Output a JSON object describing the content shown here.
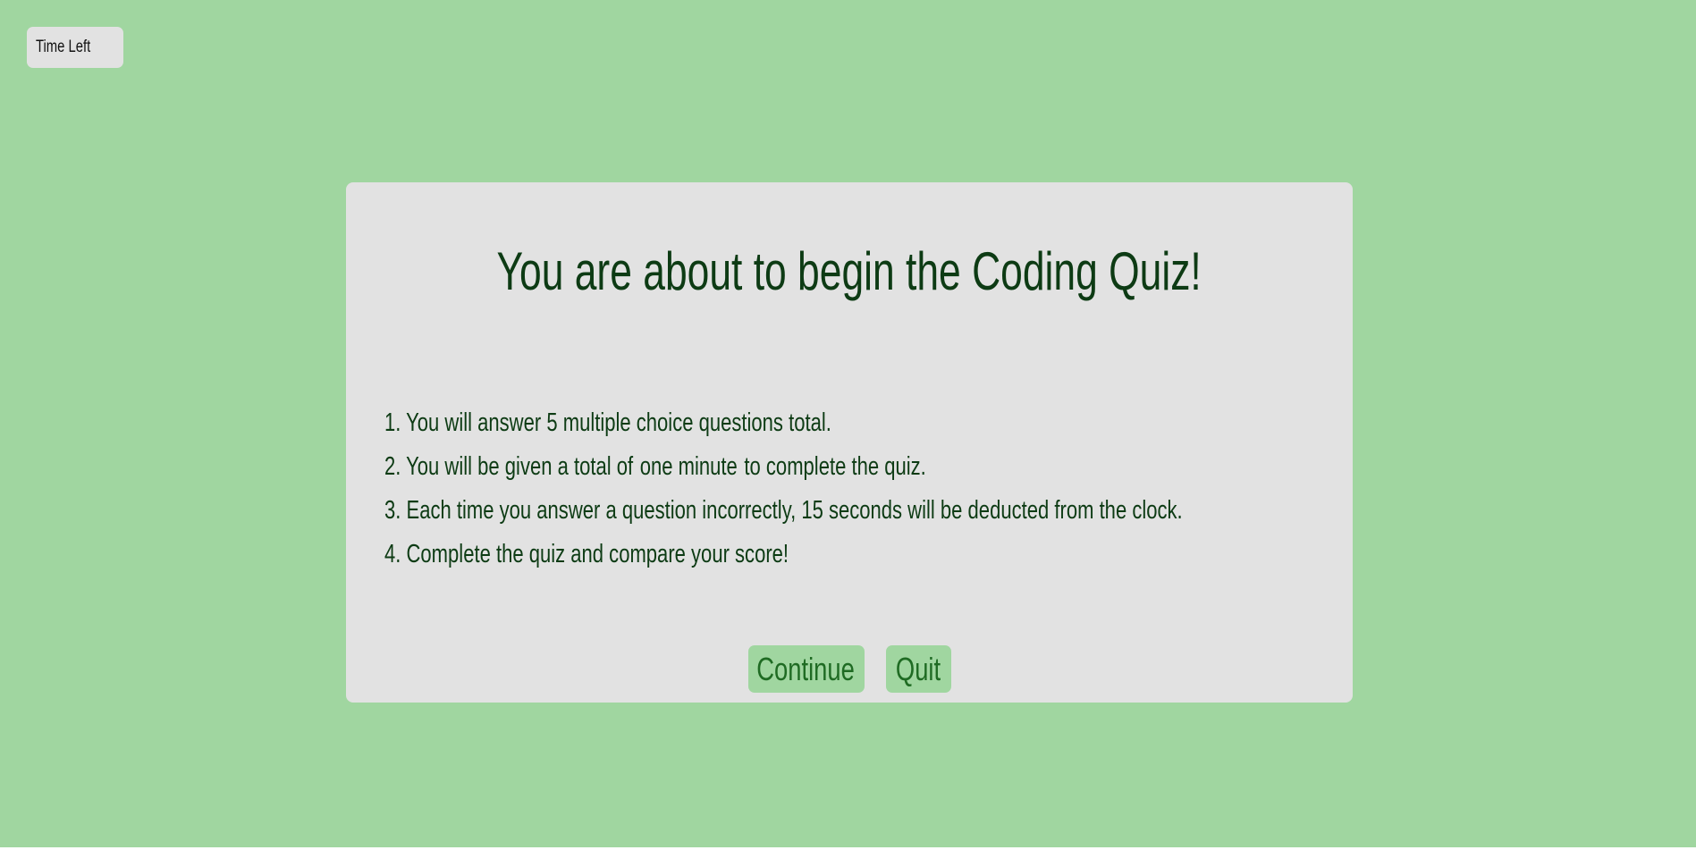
{
  "timer": {
    "label": "Time Left"
  },
  "intro": {
    "title": "You are about to begin the Coding Quiz!",
    "rules": [
      {
        "prefix": "1. You will answer 5 multiple choice questions total."
      },
      {
        "prefix": "2. You will be given a total of",
        "highlight": "one minute",
        "suffix": "to complete the quiz."
      },
      {
        "prefix": "3. Each time you answer a question incorrectly, 15 seconds will be deducted from the clock."
      },
      {
        "prefix": "4. Complete the quiz and compare your score!"
      }
    ],
    "continue_label": "Continue",
    "quit_label": "Quit"
  },
  "colors": {
    "background": "#a0d6a0",
    "card": "#e2e2e2",
    "text_dark_green": "#0d3b14",
    "button_text": "#1f6b23"
  }
}
